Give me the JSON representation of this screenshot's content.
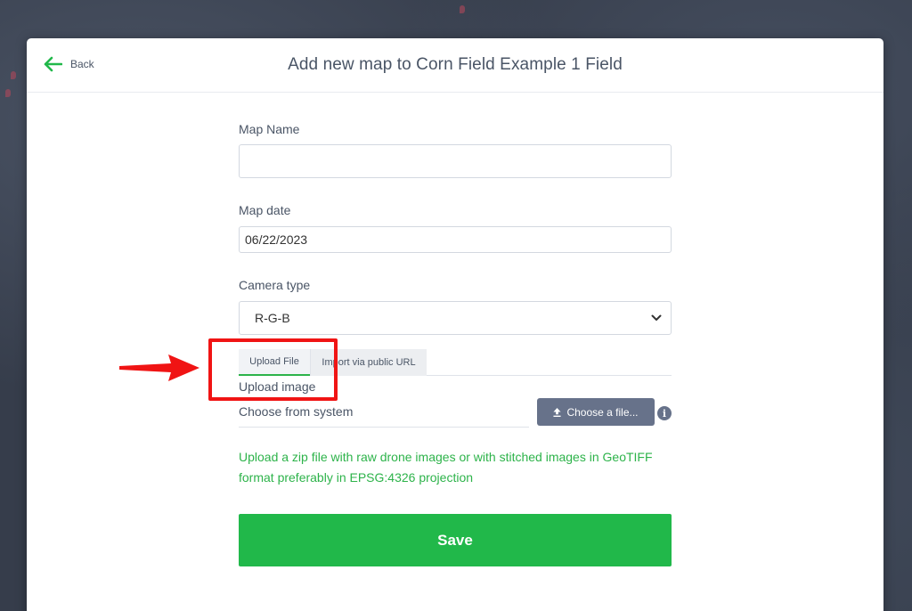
{
  "header": {
    "back_label": "Back",
    "title": "Add new map to Corn Field Example 1 Field"
  },
  "form": {
    "map_name": {
      "label": "Map Name",
      "value": "",
      "placeholder": ""
    },
    "map_date": {
      "label": "Map date",
      "value": "06/22/2023"
    },
    "camera_type": {
      "label": "Camera type",
      "selected": "R-G-B"
    },
    "tabs": [
      {
        "label": "Upload File",
        "active": true
      },
      {
        "label": "Import via public URL",
        "active": false
      }
    ],
    "upload": {
      "label": "Upload image",
      "choose_text": "Choose from system",
      "button_label": "Choose a file...",
      "info_glyph": "i"
    },
    "hint": "Upload a zip file with raw drone images or with stitched images in GeoTIFF format preferably in EPSG:4326 projection",
    "save_label": "Save"
  },
  "colors": {
    "accent_green": "#21b84a",
    "hint_green": "#2db34a",
    "annotation_red": "#f01414",
    "button_slate": "#67728a"
  },
  "icons": {
    "back": "arrow-left-icon",
    "dropdown": "chevron-down-icon",
    "upload": "upload-icon",
    "info": "info-icon"
  }
}
